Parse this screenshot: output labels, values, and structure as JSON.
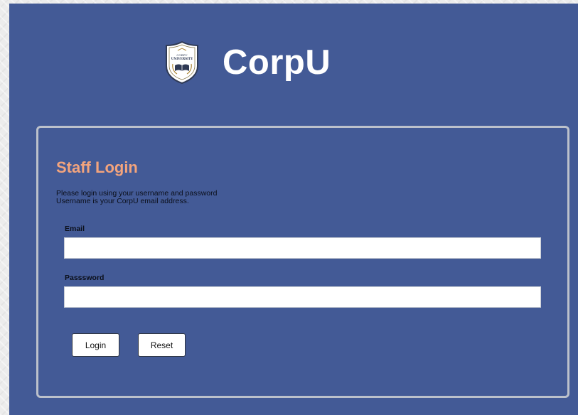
{
  "brand": {
    "name": "CorpU",
    "logo_text_top": "CORPU",
    "logo_text_main": "UNIVERSITY",
    "logo_icon": "book-seal-icon"
  },
  "login": {
    "title": "Staff Login",
    "instruction_line1": "Please login using your username and password",
    "instruction_line2": "Username is your CorpU email address.",
    "email_label": "Email",
    "email_value": "",
    "password_label": "Passsword",
    "password_value": "",
    "login_button": "Login",
    "reset_button": "Reset"
  },
  "colors": {
    "panel_background": "#435a96",
    "title_accent": "#f3a47d",
    "card_border": "#bcc1cb",
    "page_background": "#ececec"
  }
}
